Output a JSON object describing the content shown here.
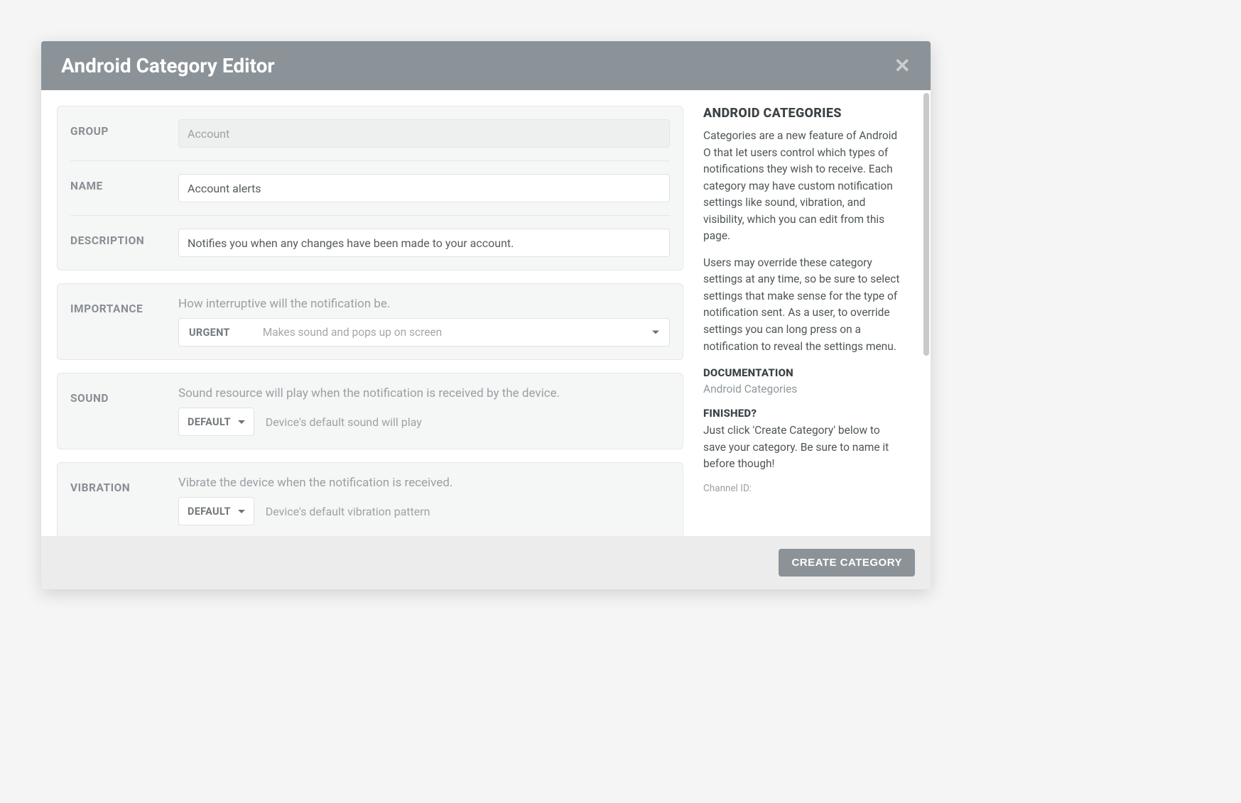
{
  "header": {
    "title": "Android Category Editor"
  },
  "form": {
    "group": {
      "label": "GROUP",
      "value": "Account"
    },
    "name": {
      "label": "NAME",
      "value": "Account alerts"
    },
    "description": {
      "label": "DESCRIPTION",
      "value": "Notifies you when any changes have been made to your account."
    },
    "importance": {
      "label": "IMPORTANCE",
      "helper": "How interruptive will the notification be.",
      "value": "URGENT",
      "desc": "Makes sound and pops up on screen"
    },
    "sound": {
      "label": "SOUND",
      "helper": "Sound resource will play when the notification is received by the device.",
      "value": "DEFAULT",
      "desc": "Device's default sound will play"
    },
    "vibration": {
      "label": "VIBRATION",
      "helper": "Vibrate the device when the notification is received.",
      "value": "DEFAULT",
      "desc": "Device's default vibration pattern"
    }
  },
  "sidebar": {
    "heading": "ANDROID CATEGORIES",
    "p1": "Categories are a new feature of Android O that let users control which types of notifications they wish to receive. Each category may have custom notification settings like sound, vibration, and visibility, which you can edit from this page.",
    "p2": "Users may override these category settings at any time, so be sure to select settings that make sense for the type of notification sent. As a user, to override settings you can long press on a notification to reveal the settings menu.",
    "doc_heading": "DOCUMENTATION",
    "doc_link": "Android Categories",
    "finished_heading": "FINISHED?",
    "finished_text": "Just click 'Create Category' below to save your category. Be sure to name it before though!",
    "channel_label": "Channel ID:"
  },
  "footer": {
    "submit": "CREATE CATEGORY"
  }
}
